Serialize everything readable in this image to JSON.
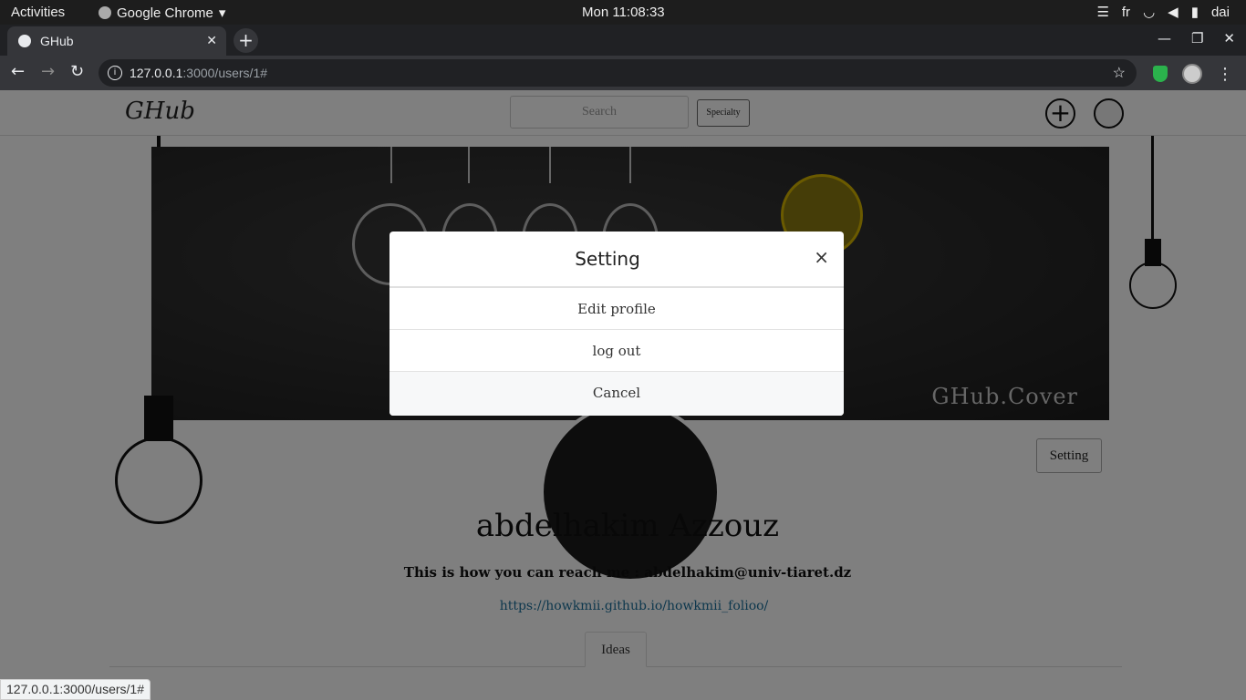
{
  "os": {
    "activities": "Activities",
    "app_name": "Google Chrome",
    "clock": "Mon 11:08:33",
    "lang": "fr",
    "user": "dai"
  },
  "browser": {
    "tab_title": "GHub",
    "url_host": "127.0.0.1",
    "url_path": ":3000/users/1#",
    "status_url": "127.0.0.1:3000/users/1#"
  },
  "site": {
    "brand": "GHub",
    "search_placeholder": "Search",
    "specialty_label": "Specialty",
    "cover_label": "GHub.Cover",
    "setting_label": "Setting",
    "user_name": "abdelhakim Azzouz",
    "reach_text": "This is how you can reach me : abdelhakim@univ-tiaret.dz",
    "link": "https://howkmii.github.io/howkmii_folioo/",
    "ideas_tab": "Ideas"
  },
  "modal": {
    "title": "Setting",
    "close": "×",
    "items": [
      "Edit profile",
      "log out",
      "Cancel"
    ]
  },
  "colors": {
    "link": "#1b6f9a",
    "overlay": "rgba(0,0,0,0.5)",
    "bulb_accent": "#d4b400"
  }
}
